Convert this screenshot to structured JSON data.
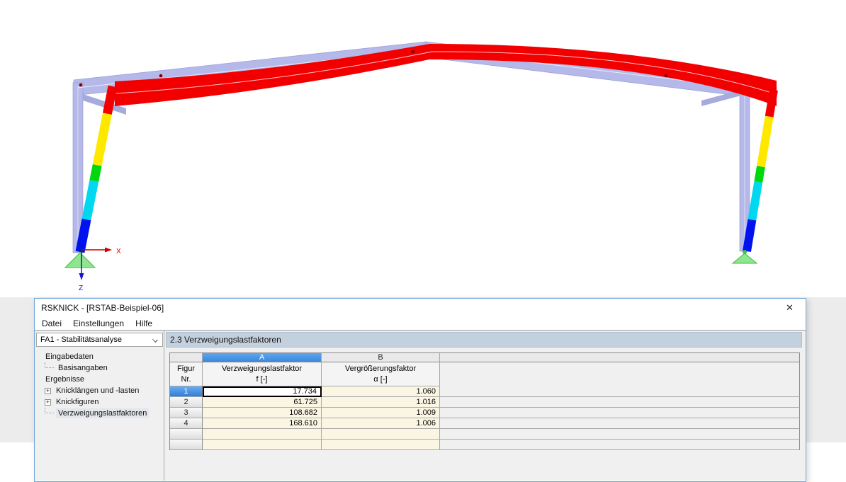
{
  "viewer": {
    "description": "Portal frame with first buckling mode shape (RSTAB model)",
    "axis_labels": {
      "x": "X",
      "z": "Z"
    },
    "colors": {
      "undeformed": "#b5b9e9",
      "undeformed_shade": "#a6aadd",
      "mode_red": "#f20000",
      "mode_yellow": "#ffe800",
      "mode_green": "#00d80e",
      "mode_cyan": "#00d8f0",
      "mode_blue": "#0012ee",
      "support_green": "#90e690",
      "node_dot": "#800000",
      "axis_x": "#cc0000",
      "axis_z": "#1515cc"
    }
  },
  "window": {
    "title": "RSKNICK - [RSTAB-Beispiel-06]",
    "close_glyph": "✕",
    "menu": [
      "Datei",
      "Einstellungen",
      "Hilfe"
    ],
    "case_selector": "FA1 - Stabilitätsanalyse",
    "tree_expand_glyph": "+",
    "tree": [
      {
        "label": "Eingabedaten"
      },
      {
        "label": "Basisangaben"
      },
      {
        "label": "Ergebnisse"
      },
      {
        "label": "Knicklängen und -lasten",
        "expandable": true
      },
      {
        "label": "Knickfiguren",
        "expandable": true
      },
      {
        "label": "Verzweigungslastfaktoren",
        "selected": true
      }
    ],
    "section_title": "2.3 Verzweigungslastfaktoren",
    "table": {
      "column_letters": [
        "A",
        "B"
      ],
      "corner": [
        "Figur",
        "Nr."
      ],
      "columns": [
        {
          "title": "Verzweigungslastfaktor",
          "unit": "f [-]"
        },
        {
          "title": "Vergrößerungsfaktor",
          "unit": "α [-]"
        }
      ],
      "rows": [
        {
          "nr": "1",
          "f": "17.734",
          "alpha": "1.060",
          "selected": true
        },
        {
          "nr": "2",
          "f": "61.725",
          "alpha": "1.016",
          "selected": false
        },
        {
          "nr": "3",
          "f": "108.682",
          "alpha": "1.009",
          "selected": false
        },
        {
          "nr": "4",
          "f": "168.610",
          "alpha": "1.006",
          "selected": false
        }
      ]
    }
  }
}
